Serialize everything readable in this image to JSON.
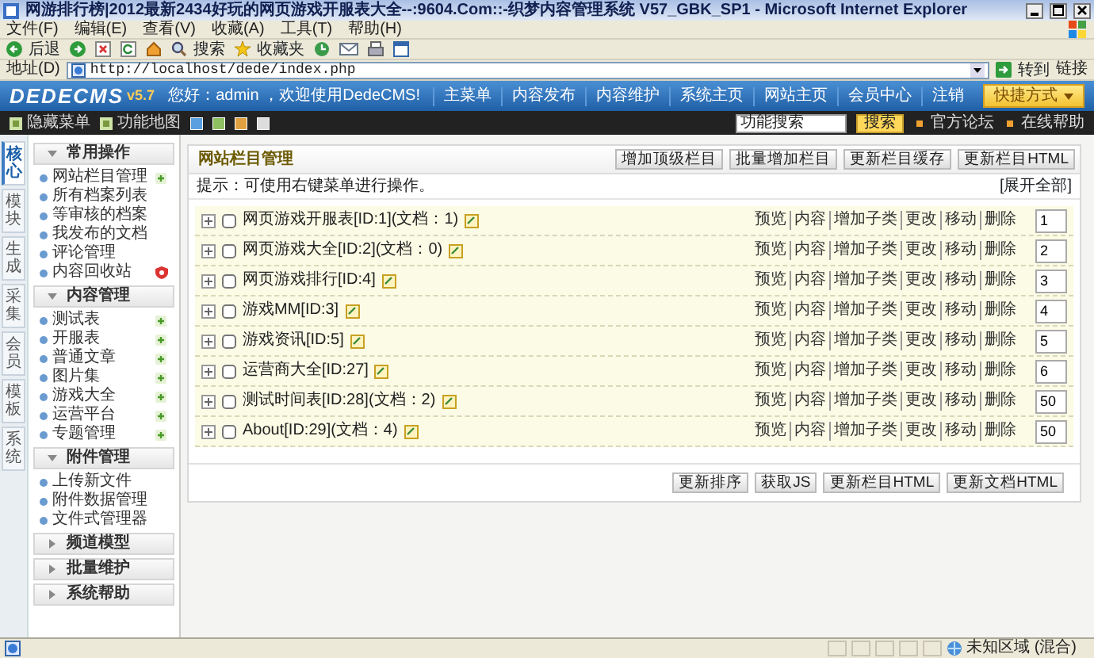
{
  "window": {
    "title": "网游排行榜|2012最新2434好玩的网页游戏开服表大全--:9604.Com::-织梦内容管理系统 V57_GBK_SP1 - Microsoft Internet Explorer"
  },
  "menu_bar": [
    "文件(F)",
    "编辑(E)",
    "查看(V)",
    "收藏(A)",
    "工具(T)",
    "帮助(H)"
  ],
  "toolbar": {
    "back": "后退",
    "search": "搜索",
    "favorites": "收藏夹"
  },
  "address_bar": {
    "label": "地址(D)",
    "url": "http://localhost/dede/index.php",
    "go": "转到",
    "links": "链接"
  },
  "header": {
    "logo": "DEDECMS",
    "version": "v5.7",
    "greeting": "您好：admin ，欢迎使用DedeCMS!",
    "nav": [
      "主菜单",
      "内容发布",
      "内容维护",
      "系统主页",
      "网站主页",
      "会员中心",
      "注销"
    ],
    "shortcut": "快捷方式"
  },
  "subbar": {
    "hide_menu": "隐藏菜单",
    "map": "功能地图",
    "search_value": "功能搜索",
    "search_button": "搜索",
    "links": [
      "官方论坛",
      "在线帮助"
    ]
  },
  "side_tabs": [
    {
      "label": "核心",
      "selected": true
    },
    {
      "label": "模块",
      "selected": false
    },
    {
      "label": "生成",
      "selected": false
    },
    {
      "label": "采集",
      "selected": false
    },
    {
      "label": "会员",
      "selected": false
    },
    {
      "label": "模板",
      "selected": false
    },
    {
      "label": "系统",
      "selected": false
    }
  ],
  "sidebar": [
    {
      "title": "常用操作",
      "expanded": true,
      "items": [
        {
          "label": "网站栏目管理",
          "kind": "add"
        },
        {
          "label": "所有档案列表",
          "kind": "plain"
        },
        {
          "label": "等审核的档案",
          "kind": "plain"
        },
        {
          "label": "我发布的文档",
          "kind": "plain"
        },
        {
          "label": "评论管理",
          "kind": "plain"
        },
        {
          "label": "内容回收站",
          "kind": "recycle"
        }
      ]
    },
    {
      "title": "内容管理",
      "expanded": true,
      "items": [
        {
          "label": "测试表",
          "kind": "add"
        },
        {
          "label": "开服表",
          "kind": "add"
        },
        {
          "label": "普通文章",
          "kind": "add"
        },
        {
          "label": "图片集",
          "kind": "add"
        },
        {
          "label": "游戏大全",
          "kind": "add"
        },
        {
          "label": "运营平台",
          "kind": "add"
        },
        {
          "label": "专题管理",
          "kind": "add"
        }
      ]
    },
    {
      "title": "附件管理",
      "expanded": true,
      "items": [
        {
          "label": "上传新文件",
          "kind": "plain"
        },
        {
          "label": "附件数据管理",
          "kind": "plain"
        },
        {
          "label": "文件式管理器",
          "kind": "plain"
        }
      ]
    },
    {
      "title": "频道模型",
      "expanded": false
    },
    {
      "title": "批量维护",
      "expanded": false
    },
    {
      "title": "系统帮助",
      "expanded": false
    }
  ],
  "panel": {
    "title": "网站栏目管理",
    "buttons": [
      "增加顶级栏目",
      "批量增加栏目",
      "更新栏目缓存",
      "更新栏目HTML"
    ],
    "hint": "提示：可使用右键菜单进行操作。",
    "expand_all": "[展开全部]",
    "rows": [
      {
        "name": "网页游戏开服表[ID:1](文档：1)",
        "checked": false,
        "actions": [
          "预览",
          "内容",
          "增加子类",
          "更改",
          "移动",
          "删除"
        ],
        "order": "1"
      },
      {
        "name": "网页游戏大全[ID:2](文档：0)",
        "checked": false,
        "actions": [
          "预览",
          "内容",
          "增加子类",
          "更改",
          "移动",
          "删除"
        ],
        "order": "2"
      },
      {
        "name": "网页游戏排行[ID:4]",
        "checked": false,
        "actions": [
          "预览",
          "内容",
          "增加子类",
          "更改",
          "移动",
          "删除"
        ],
        "order": "3"
      },
      {
        "name": "游戏MM[ID:3]",
        "checked": false,
        "actions": [
          "预览",
          "内容",
          "增加子类",
          "更改",
          "移动",
          "删除"
        ],
        "order": "4"
      },
      {
        "name": "游戏资讯[ID:5]",
        "checked": false,
        "actions": [
          "预览",
          "内容",
          "增加子类",
          "更改",
          "移动",
          "删除"
        ],
        "order": "5"
      },
      {
        "name": "运营商大全[ID:27]",
        "checked": false,
        "actions": [
          "预览",
          "内容",
          "增加子类",
          "更改",
          "移动",
          "删除"
        ],
        "order": "6"
      },
      {
        "name": "测试时间表[ID:28](文档：2)",
        "checked": false,
        "actions": [
          "预览",
          "内容",
          "增加子类",
          "更改",
          "移动",
          "删除"
        ],
        "order": "50"
      },
      {
        "name": "About[ID:29](文档：4)",
        "checked": false,
        "actions": [
          "预览",
          "内容",
          "增加子类",
          "更改",
          "移动",
          "删除"
        ],
        "order": "50"
      }
    ],
    "footer_buttons": [
      "更新排序",
      "获取JS",
      "更新栏目HTML",
      "更新文档HTML"
    ]
  },
  "status_bar": {
    "zone": "未知区域 (混合)"
  }
}
